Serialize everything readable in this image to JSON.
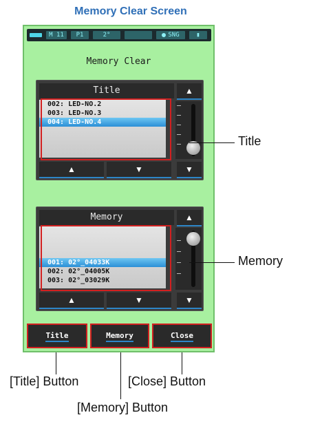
{
  "caption": "Memory Clear Screen",
  "status_bar": {
    "items": [
      "M 11",
      "P1",
      "2°",
      "SNG"
    ]
  },
  "screen_title": "Memory Clear",
  "title_panel": {
    "header": "Title",
    "items": [
      "002: LED-NO.2",
      "003: LED-NO.3",
      "004: LED-NO.4"
    ],
    "selected_index": 2
  },
  "memory_panel": {
    "header": "Memory",
    "items": [
      "001: 02°_04033K",
      "002: 02°_04005K",
      "003: 02°_03029K"
    ],
    "selected_index": 0
  },
  "buttons": {
    "title": "Title",
    "memory": "Memory",
    "close": "Close"
  },
  "nav": {
    "up": "▲",
    "down": "▼",
    "top": "⏫",
    "bottom": "⏬"
  },
  "annotations": {
    "title": "Title",
    "memory": "Memory",
    "title_button": "[Title] Button",
    "close_button": "[Close] Button",
    "memory_button": "[Memory] Button"
  }
}
